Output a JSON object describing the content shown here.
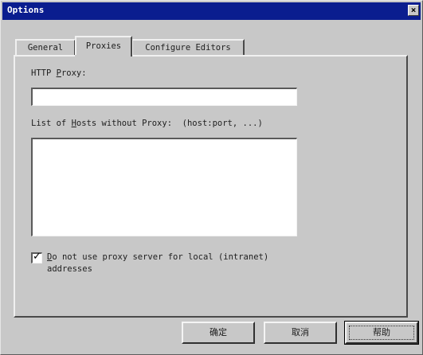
{
  "window": {
    "title": "Options",
    "close_label": "×"
  },
  "tabs": [
    {
      "label": "General",
      "active": false
    },
    {
      "label": "Proxies",
      "active": true
    },
    {
      "label": "Configure Editors",
      "active": false
    }
  ],
  "proxies": {
    "http_proxy_prefix": "HTTP ",
    "http_proxy_accel": "P",
    "http_proxy_suffix": "roxy:",
    "http_proxy_value": "",
    "hosts_prefix": "List of ",
    "hosts_accel": "H",
    "hosts_suffix": "osts without Proxy:  (host:port, ...)",
    "hosts_value": "",
    "bypass_checked": true,
    "bypass_check_glyph": "✓",
    "bypass_accel": "D",
    "bypass_line1_rest": "o not use proxy server for local (intranet)",
    "bypass_line2": "addresses"
  },
  "buttons": {
    "ok": "确定",
    "cancel": "取消",
    "help": "帮助"
  }
}
